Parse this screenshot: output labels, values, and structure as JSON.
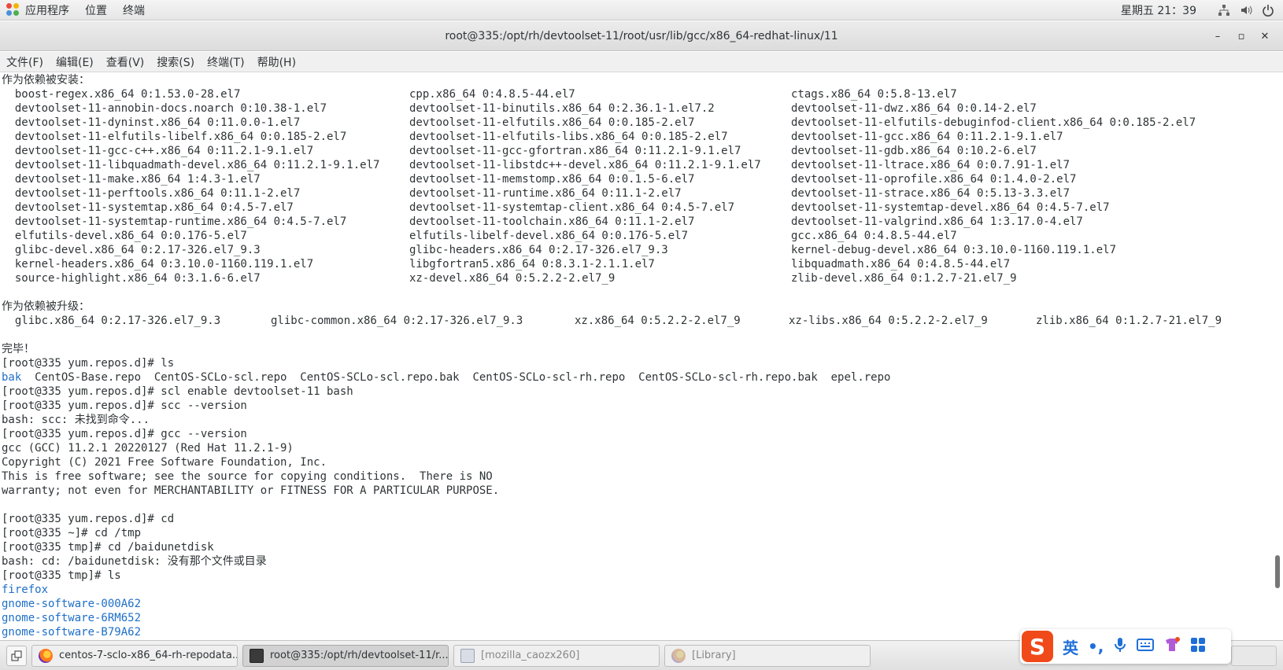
{
  "top_panel": {
    "applications": "应用程序",
    "places": "位置",
    "terminal": "终端",
    "clock": "星期五 21：39"
  },
  "window": {
    "title": "root@335:/opt/rh/devtoolset-11/root/usr/lib/gcc/x86_64-redhat-linux/11",
    "minimize": "–",
    "maximize": "▫",
    "close": "✕"
  },
  "menubar": [
    "文件(F)",
    "编辑(E)",
    "查看(V)",
    "搜索(S)",
    "终端(T)",
    "帮助(H)"
  ],
  "terminal": {
    "dep_installed_header": "作为依赖被安装：",
    "dep_installed_rows": [
      [
        "  boost-regex.x86_64 0:1.53.0-28.el7",
        "cpp.x86_64 0:4.8.5-44.el7",
        "ctags.x86_64 0:5.8-13.el7"
      ],
      [
        "  devtoolset-11-annobin-docs.noarch 0:10.38-1.el7",
        "devtoolset-11-binutils.x86_64 0:2.36.1-1.el7.2",
        "devtoolset-11-dwz.x86_64 0:0.14-2.el7"
      ],
      [
        "  devtoolset-11-dyninst.x86_64 0:11.0.0-1.el7",
        "devtoolset-11-elfutils.x86_64 0:0.185-2.el7",
        "devtoolset-11-elfutils-debuginfod-client.x86_64 0:0.185-2.el7"
      ],
      [
        "  devtoolset-11-elfutils-libelf.x86_64 0:0.185-2.el7",
        "devtoolset-11-elfutils-libs.x86_64 0:0.185-2.el7",
        "devtoolset-11-gcc.x86_64 0:11.2.1-9.1.el7"
      ],
      [
        "  devtoolset-11-gcc-c++.x86_64 0:11.2.1-9.1.el7",
        "devtoolset-11-gcc-gfortran.x86_64 0:11.2.1-9.1.el7",
        "devtoolset-11-gdb.x86_64 0:10.2-6.el7"
      ],
      [
        "  devtoolset-11-libquadmath-devel.x86_64 0:11.2.1-9.1.el7",
        "devtoolset-11-libstdc++-devel.x86_64 0:11.2.1-9.1.el7",
        "devtoolset-11-ltrace.x86_64 0:0.7.91-1.el7"
      ],
      [
        "  devtoolset-11-make.x86_64 1:4.3-1.el7",
        "devtoolset-11-memstomp.x86_64 0:0.1.5-6.el7",
        "devtoolset-11-oprofile.x86_64 0:1.4.0-2.el7"
      ],
      [
        "  devtoolset-11-perftools.x86_64 0:11.1-2.el7",
        "devtoolset-11-runtime.x86_64 0:11.1-2.el7",
        "devtoolset-11-strace.x86_64 0:5.13-3.3.el7"
      ],
      [
        "  devtoolset-11-systemtap.x86_64 0:4.5-7.el7",
        "devtoolset-11-systemtap-client.x86_64 0:4.5-7.el7",
        "devtoolset-11-systemtap-devel.x86_64 0:4.5-7.el7"
      ],
      [
        "  devtoolset-11-systemtap-runtime.x86_64 0:4.5-7.el7",
        "devtoolset-11-toolchain.x86_64 0:11.1-2.el7",
        "devtoolset-11-valgrind.x86_64 1:3.17.0-4.el7"
      ],
      [
        "  elfutils-devel.x86_64 0:0.176-5.el7",
        "elfutils-libelf-devel.x86_64 0:0.176-5.el7",
        "gcc.x86_64 0:4.8.5-44.el7"
      ],
      [
        "  glibc-devel.x86_64 0:2.17-326.el7_9.3",
        "glibc-headers.x86_64 0:2.17-326.el7_9.3",
        "kernel-debug-devel.x86_64 0:3.10.0-1160.119.1.el7"
      ],
      [
        "  kernel-headers.x86_64 0:3.10.0-1160.119.1.el7",
        "libgfortran5.x86_64 0:8.3.1-2.1.1.el7",
        "libquadmath.x86_64 0:4.8.5-44.el7"
      ],
      [
        "  source-highlight.x86_64 0:3.1.6-6.el7",
        "xz-devel.x86_64 0:5.2.2-2.el7_9",
        "zlib-devel.x86_64 0:1.2.7-21.el7_9"
      ]
    ],
    "dep_updated_header": "作为依赖被升级：",
    "dep_updated_row": [
      "  glibc.x86_64 0:2.17-326.el7_9.3",
      "glibc-common.x86_64 0:2.17-326.el7_9.3",
      "xz.x86_64 0:5.2.2-2.el7_9",
      "xz-libs.x86_64 0:5.2.2-2.el7_9",
      "zlib.x86_64 0:1.2.7-21.el7_9"
    ],
    "done": "完毕！",
    "prompt_ls": "[root@335 yum.repos.d]# ls",
    "ls_blue": "bak",
    "ls_rest": "  CentOS-Base.repo  CentOS-SCLo-scl.repo  CentOS-SCLo-scl.repo.bak  CentOS-SCLo-scl-rh.repo  CentOS-SCLo-scl-rh.repo.bak  epel.repo",
    "scl_enable": "[root@335 yum.repos.d]# scl enable devtoolset-11 bash",
    "scc_cmd": "[root@335 yum.repos.d]# scc --version",
    "scc_err": "bash: scc: 未找到命令...",
    "gcc_cmd": "[root@335 yum.repos.d]# gcc --version",
    "gcc_out1": "gcc (GCC) 11.2.1 20220127 (Red Hat 11.2.1-9)",
    "gcc_out2": "Copyright (C) 2021 Free Software Foundation, Inc.",
    "gcc_out3": "This is free software; see the source for copying conditions.  There is NO",
    "gcc_out4": "warranty; not even for MERCHANTABILITY or FITNESS FOR A PARTICULAR PURPOSE.",
    "cd_cmd": "[root@335 yum.repos.d]# cd",
    "cd_tmp": "[root@335 ~]# cd /tmp",
    "cd_baidu": "[root@335 tmp]# cd /baidunetdisk",
    "cd_err": "bash: cd: /baidunetdisk: 没有那个文件或目录",
    "ls_tmp": "[root@335 tmp]# ls",
    "tmp_entries": [
      "firefox",
      "gnome-software-000A62",
      "gnome-software-6RM652",
      "gnome-software-B79A62"
    ]
  },
  "taskbar": {
    "tasks": [
      {
        "label": "centos-7-sclo-x86_64-rh-repodata..."
      },
      {
        "label": "root@335:/opt/rh/devtoolset-11/r..."
      },
      {
        "label": "[mozilla_caozx260]"
      },
      {
        "label": "[Library]"
      }
    ]
  },
  "ime": {
    "logo": "S",
    "lang": "英",
    "punct": "•,"
  },
  "colors": {
    "link_blue": "#1e6fc8",
    "ime_orange": "#f04a1a"
  }
}
